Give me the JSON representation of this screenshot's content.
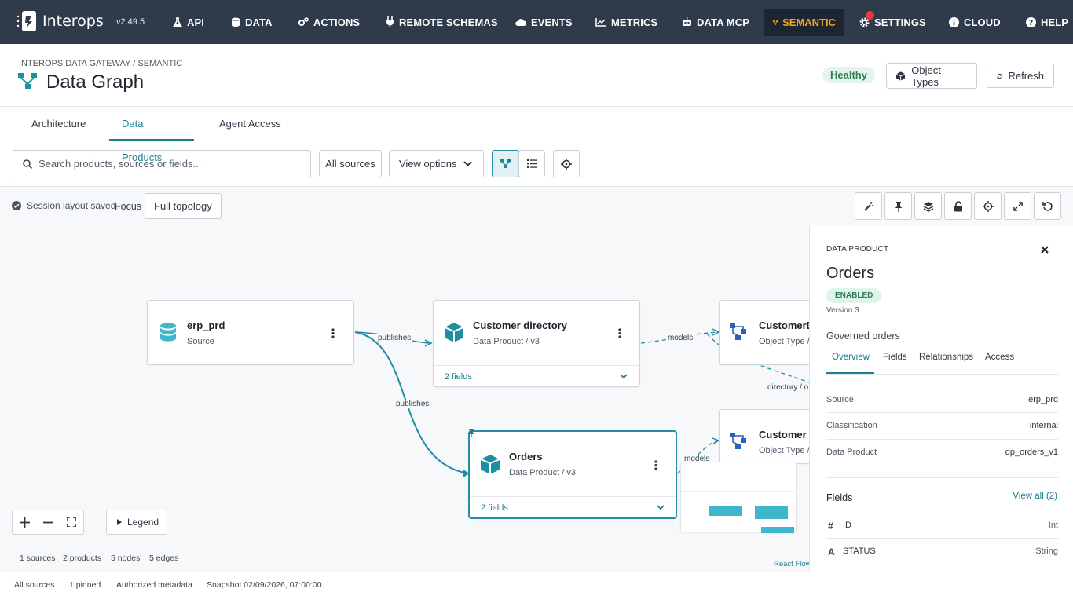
{
  "nav": {
    "brand": "Interops",
    "version": "v2.49.5",
    "items": [
      "API",
      "DATA",
      "ACTIONS",
      "REMOTE SCHEMAS",
      "EVENTS",
      "METRICS",
      "DATA MCP",
      "SEMANTIC",
      "SETTINGS",
      "CLOUD",
      "HELP"
    ],
    "active": "SEMANTIC",
    "settings_badge": "!",
    "accent": "#f5a524",
    "bg": "#2f3a4a"
  },
  "header": {
    "breadcrumb": "INTEROPS DATA GATEWAY / SEMANTIC",
    "title": "Data Graph",
    "health": "Healthy",
    "object_types_label": "Object Types",
    "refresh_label": "Refresh"
  },
  "tabs": [
    "Architecture",
    "Data Products",
    "Agent Access"
  ],
  "active_tab": "Data Products",
  "toolbar": {
    "search_placeholder": "Search products, sources or fields...",
    "sources_label": "All sources",
    "view_options_label": "View options"
  },
  "canvas_bar": {
    "saved_text": "Session layout saved",
    "focus_label": "Focus",
    "focus_value": "Full topology"
  },
  "nodes": {
    "erp": {
      "title": "erp_prd",
      "subtitle": "Source"
    },
    "customer_directory": {
      "title": "Customer directory",
      "subtitle": "Data Product / v3",
      "fields": "2 fields"
    },
    "customer_d": {
      "title": "CustomerD",
      "subtitle": "Object Type /"
    },
    "orders": {
      "title": "Orders",
      "subtitle": "Data Product / v3",
      "fields": "2 fields"
    },
    "customer": {
      "title": "Customer",
      "subtitle": "Object Type /"
    }
  },
  "edges": {
    "publishes_1": "publishes",
    "publishes_2": "publishes",
    "models_1": "models",
    "models_2": "models",
    "directory": "directory / o"
  },
  "controls": {
    "legend": "Legend",
    "attribution": "React Flow"
  },
  "stats": [
    "1 sources",
    "2 products",
    "5 nodes",
    "5 edges"
  ],
  "panel": {
    "kind": "DATA PRODUCT",
    "name": "Orders",
    "status": "ENABLED",
    "version": "Version 3",
    "description": "Governed orders",
    "tabs": [
      "Overview",
      "Fields",
      "Relationships",
      "Access"
    ],
    "properties": [
      {
        "key": "Source",
        "value": "erp_prd"
      },
      {
        "key": "Classification",
        "value": "internal"
      },
      {
        "key": "Data Product",
        "value": "dp_orders_v1"
      }
    ],
    "fields_title": "Fields",
    "view_all": "View all (2)",
    "fields": [
      {
        "icon": "#",
        "name": "ID",
        "type": "Int"
      },
      {
        "icon": "A",
        "name": "STATUS",
        "type": "String"
      }
    ]
  },
  "statusbar": [
    "All sources",
    "1 pinned",
    "Authorized metadata",
    "Snapshot 02/09/2026, 07:00:00"
  ]
}
